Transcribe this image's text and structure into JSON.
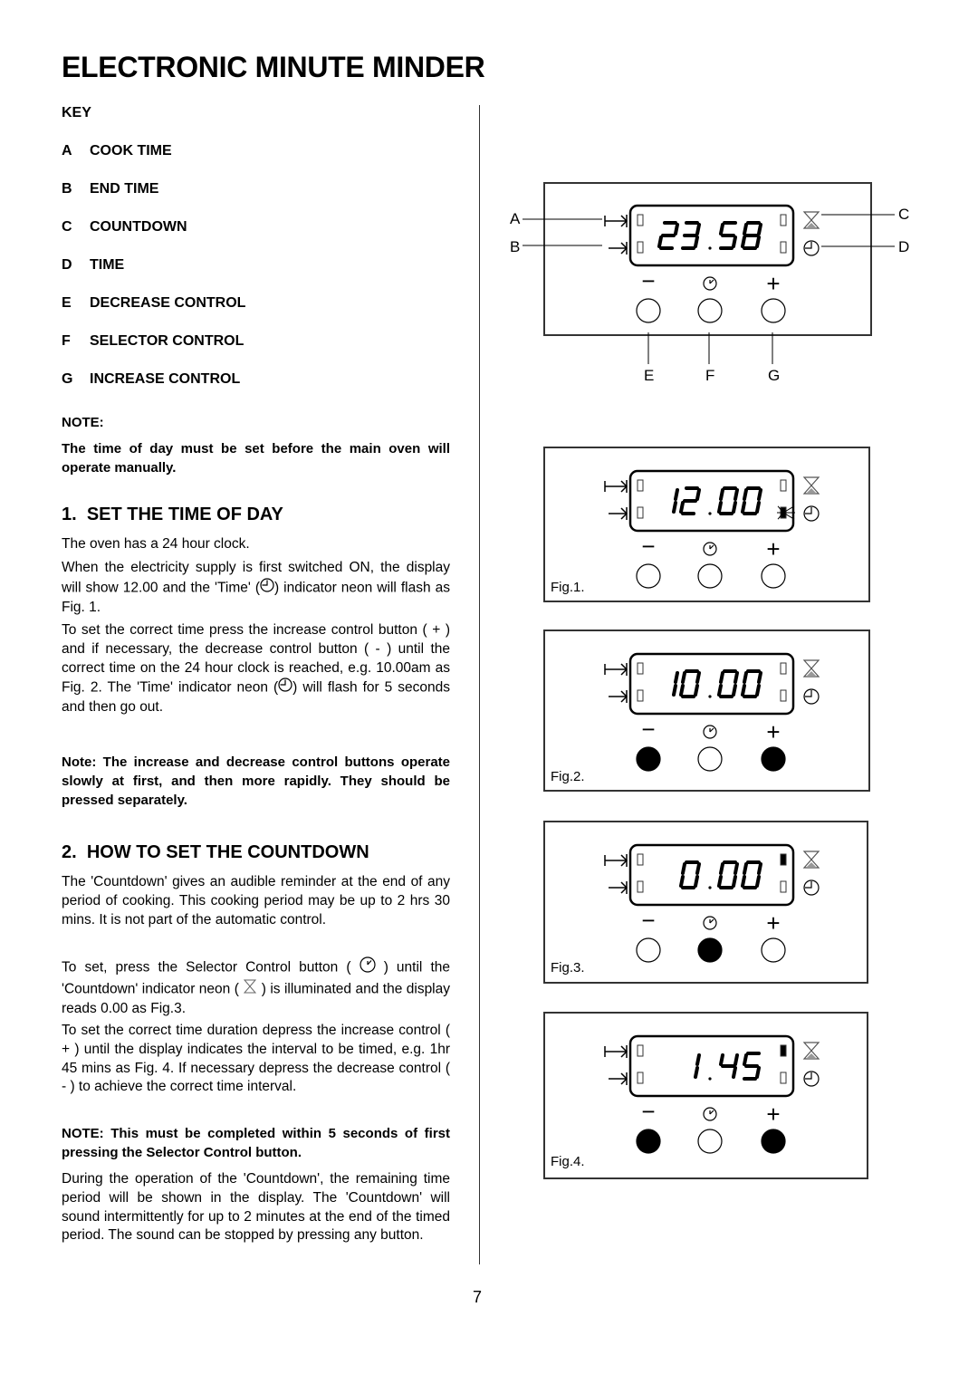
{
  "page": {
    "title": "ELECTRONIC MINUTE MINDER",
    "page_number": "7"
  },
  "key": {
    "heading": "KEY",
    "items": [
      {
        "letter": "A",
        "label": "COOK TIME"
      },
      {
        "letter": "B",
        "label": "END TIME"
      },
      {
        "letter": "C",
        "label": "COUNTDOWN"
      },
      {
        "letter": "D",
        "label": "TIME"
      },
      {
        "letter": "E",
        "label": "DECREASE CONTROL"
      },
      {
        "letter": "F",
        "label": "SELECTOR CONTROL"
      },
      {
        "letter": "G",
        "label": "INCREASE CONTROL"
      }
    ]
  },
  "note": {
    "heading": "NOTE:",
    "text": "The time of day must be set before the main oven will operate manually."
  },
  "section1": {
    "heading_num": "1.",
    "heading": "SET THE TIME OF DAY",
    "p1": "The oven has a 24 hour clock.",
    "p2a": "When the electricity supply is first switched ON, the display will show 12.00 and the 'Time' (",
    "p2b": ") indicator neon will flash as Fig. 1.",
    "p3a": "To set the correct time press the increase control button ( + ) and if necessary, the decrease control button ( - ) until the correct time on the 24 hour clock is reached,  e.g. 10.00am as Fig. 2.  The 'Time' indicator neon (",
    "p3b": ") will flash for 5 seconds and then go out.",
    "note": "Note: The increase and decrease control buttons operate slowly at first, and then more rapidly. They should be pressed separately."
  },
  "section2": {
    "heading_num": "2.",
    "heading": "HOW TO SET THE COUNTDOWN",
    "p1": "The 'Countdown' gives an audible reminder at the end of any period of cooking. This cooking period may be up to 2 hrs 30 mins. It is not part of the automatic control.",
    "p2a": "To set, press the Selector Control button (",
    "p2b": ") until the 'Countdown' indicator neon (",
    "p2c": ") is illuminated and the display reads 0.00 as Fig.3.",
    "p3": "To set the correct time duration depress the increase control ( + ) until the display indicates the interval to be timed, e.g. 1hr 45 mins as Fig. 4.  If necessary depress the decrease control ( - ) to achieve the correct time interval.",
    "note": "NOTE:  This must be completed within 5 seconds of first pressing the Selector Control button.",
    "p4": "During the operation of the 'Countdown', the remaining time period will be shown in the display. The 'Countdown' will sound intermittently for up to 2 minutes at the end of the timed period.  The sound can be stopped by pressing any button."
  },
  "figures": {
    "main": {
      "display": "23.58",
      "callouts": {
        "A": "A",
        "B": "B",
        "C": "C",
        "D": "D",
        "E": "E",
        "F": "F",
        "G": "G"
      },
      "pressed": [
        false,
        false,
        false
      ],
      "indicators": {
        "countdown": "off",
        "time": "off"
      }
    },
    "fig1": {
      "label": "Fig.1.",
      "display": "12.00",
      "pressed": [
        false,
        false,
        false
      ],
      "indicators": {
        "countdown": "off",
        "time": "flashing"
      }
    },
    "fig2": {
      "label": "Fig.2.",
      "display": "10.00",
      "pressed": [
        true,
        false,
        true
      ],
      "indicators": {
        "countdown": "off",
        "time": "off"
      }
    },
    "fig3": {
      "label": "Fig.3.",
      "display": "0.00",
      "pressed": [
        false,
        true,
        false
      ],
      "indicators": {
        "countdown": "on",
        "time": "off"
      }
    },
    "fig4": {
      "label": "Fig.4.",
      "display": "1.45",
      "pressed": [
        true,
        false,
        true
      ],
      "indicators": {
        "countdown": "on",
        "time": "off"
      }
    }
  },
  "button_symbols": {
    "decrease": "−",
    "increase": "+"
  }
}
